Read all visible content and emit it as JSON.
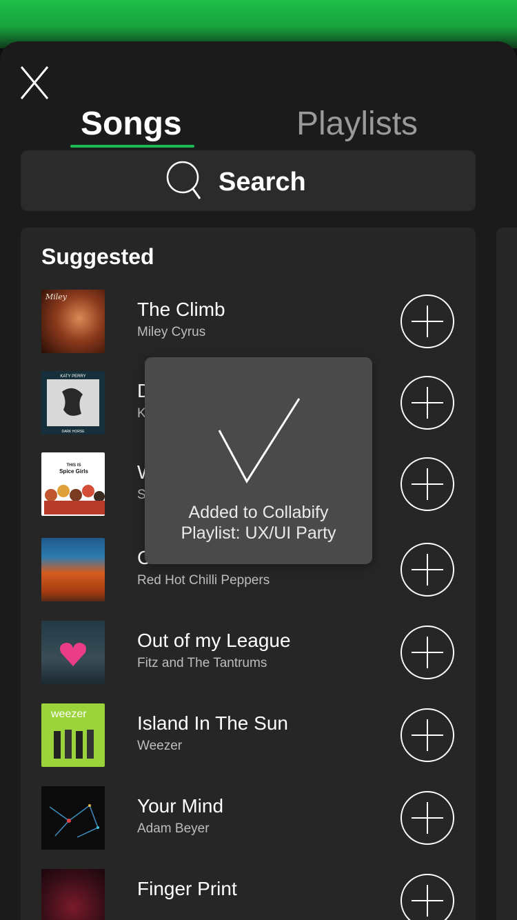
{
  "header": {
    "tabs": [
      {
        "label": "Songs",
        "active": true
      },
      {
        "label": "Playlists",
        "active": false
      }
    ]
  },
  "search": {
    "label": "Search"
  },
  "suggested": {
    "title": "Suggested",
    "songs": [
      {
        "title": "The Climb",
        "artist": "Miley Cyrus"
      },
      {
        "title": "D",
        "artist": "K"
      },
      {
        "title": "W",
        "artist": "S"
      },
      {
        "title": "C",
        "artist": "Red Hot Chilli Peppers"
      },
      {
        "title": "Out of my League",
        "artist": "Fitz and The Tantrums"
      },
      {
        "title": "Island In The Sun",
        "artist": "Weezer"
      },
      {
        "title": "Your Mind",
        "artist": "Adam Beyer"
      },
      {
        "title": "Finger Print",
        "artist": ""
      }
    ]
  },
  "album_art_text": {
    "katy": "KATY PERRY",
    "katy_sub": "DARK HORSE",
    "spice_top": "THIS IS",
    "spice_main": "Spice Girls",
    "weezer": "weezer",
    "miley": "Miley"
  },
  "toast": {
    "line1": "Added to Collabify",
    "line2": "Playlist: UX/UI Party"
  },
  "colors": {
    "accent": "#1db954",
    "background": "#1b1b1b",
    "card": "#262626"
  }
}
